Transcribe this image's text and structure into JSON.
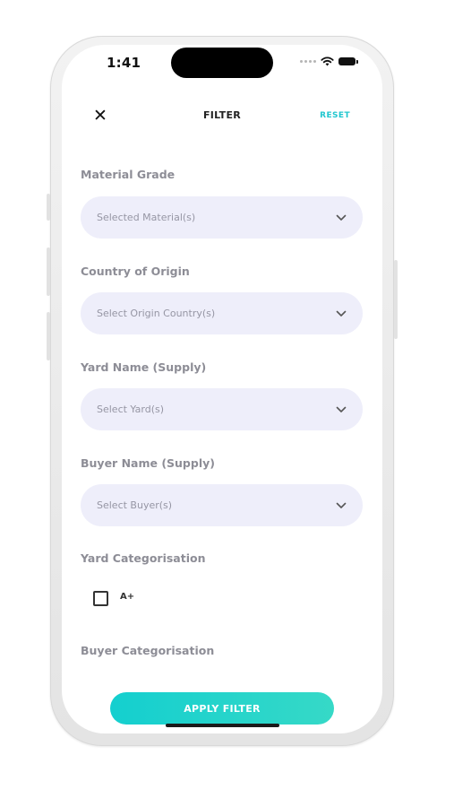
{
  "status_bar": {
    "time": "1:41"
  },
  "header": {
    "title": "FILTER",
    "reset_label": "RESET",
    "close_icon": "close-icon"
  },
  "filters": [
    {
      "label": "Material Grade",
      "placeholder": "Selected Material(s)"
    },
    {
      "label": "Country of Origin",
      "placeholder": "Select Origin Country(s)"
    },
    {
      "label": "Yard Name (Supply)",
      "placeholder": "Select Yard(s)"
    },
    {
      "label": "Buyer Name (Supply)",
      "placeholder": "Select Buyer(s)"
    }
  ],
  "yard_categorisation": {
    "label": "Yard Categorisation",
    "options": [
      {
        "label": "A+",
        "checked": false
      }
    ]
  },
  "buyer_categorisation": {
    "label": "Buyer Categorisation"
  },
  "apply_button": {
    "label": "APPLY FILTER"
  },
  "colors": {
    "accent": "#22c7cf",
    "field_bg": "#eeeefa",
    "label": "#8d8d96",
    "button_start": "#14cfcf",
    "button_end": "#36d9c7"
  }
}
